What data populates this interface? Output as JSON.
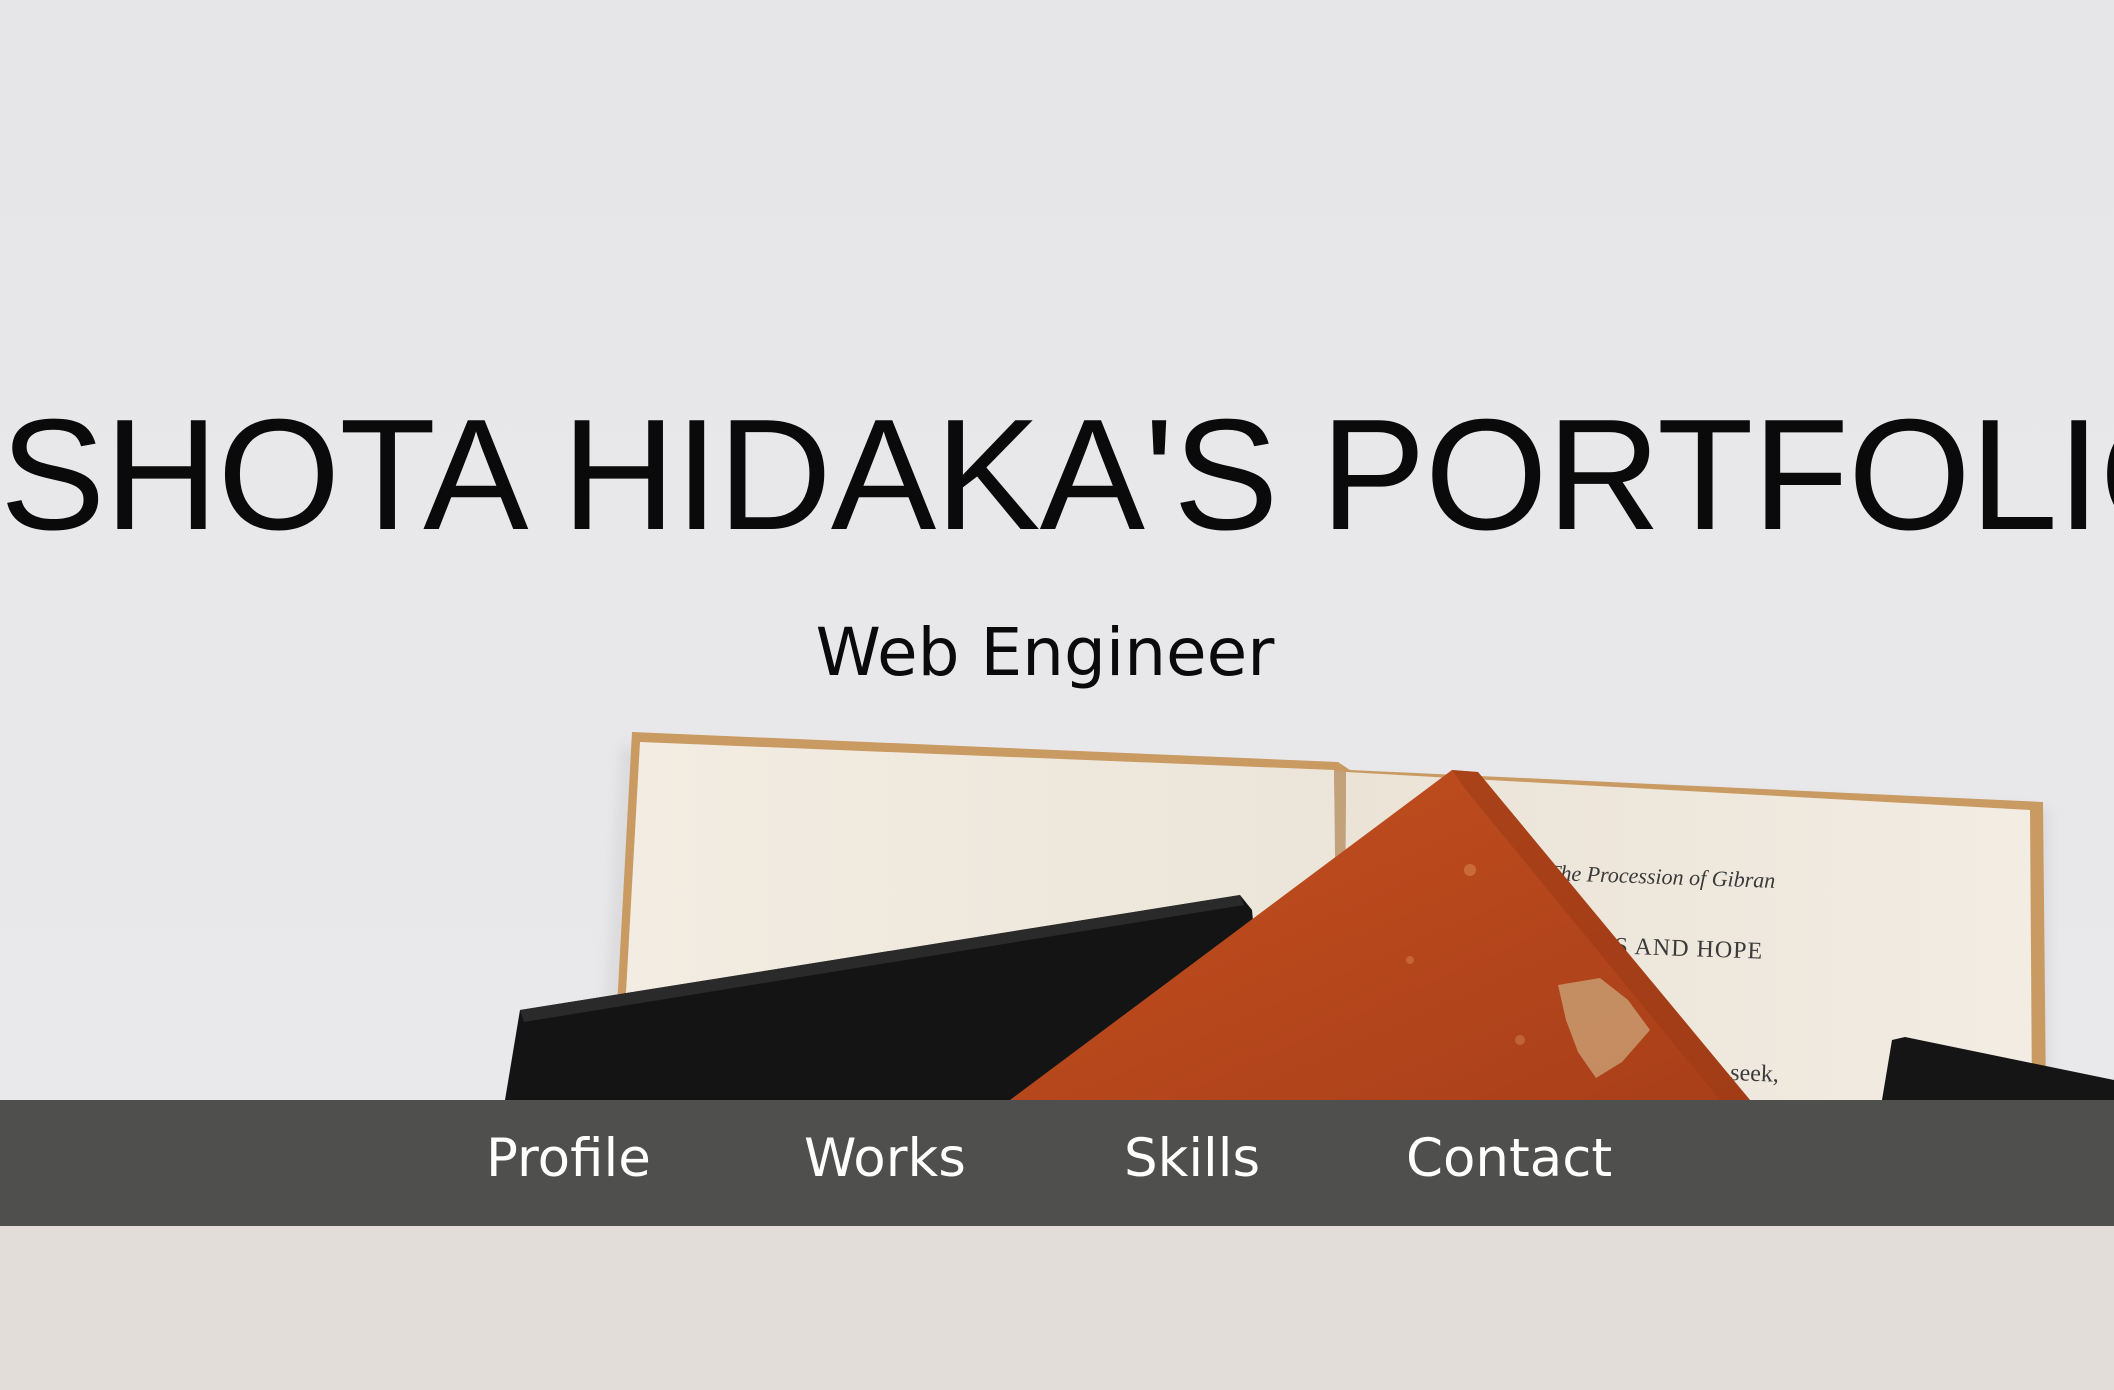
{
  "hero": {
    "title": "SHOTA HIDAKA'S PORTFOLIO",
    "subtitle": "Web Engineer",
    "background_image": "books-on-white-table-photo",
    "book_text": {
      "line1": "The Procession of Gibran",
      "line2": "SADNESS AND HOPE",
      "line3": "seek,"
    }
  },
  "nav": {
    "items": [
      {
        "label": "Profile"
      },
      {
        "label": "Works"
      },
      {
        "label": "Skills"
      },
      {
        "label": "Contact"
      }
    ]
  },
  "colors": {
    "hero_bg": "#e7e7e9",
    "nav_bg": "#4f4f4d",
    "nav_text": "#ffffff",
    "page_bg": "#e2ddd8",
    "title_text": "#0a0a0a",
    "book_orange": "#b8491f",
    "book_black": "#141414",
    "book_page": "#f1eadf"
  }
}
